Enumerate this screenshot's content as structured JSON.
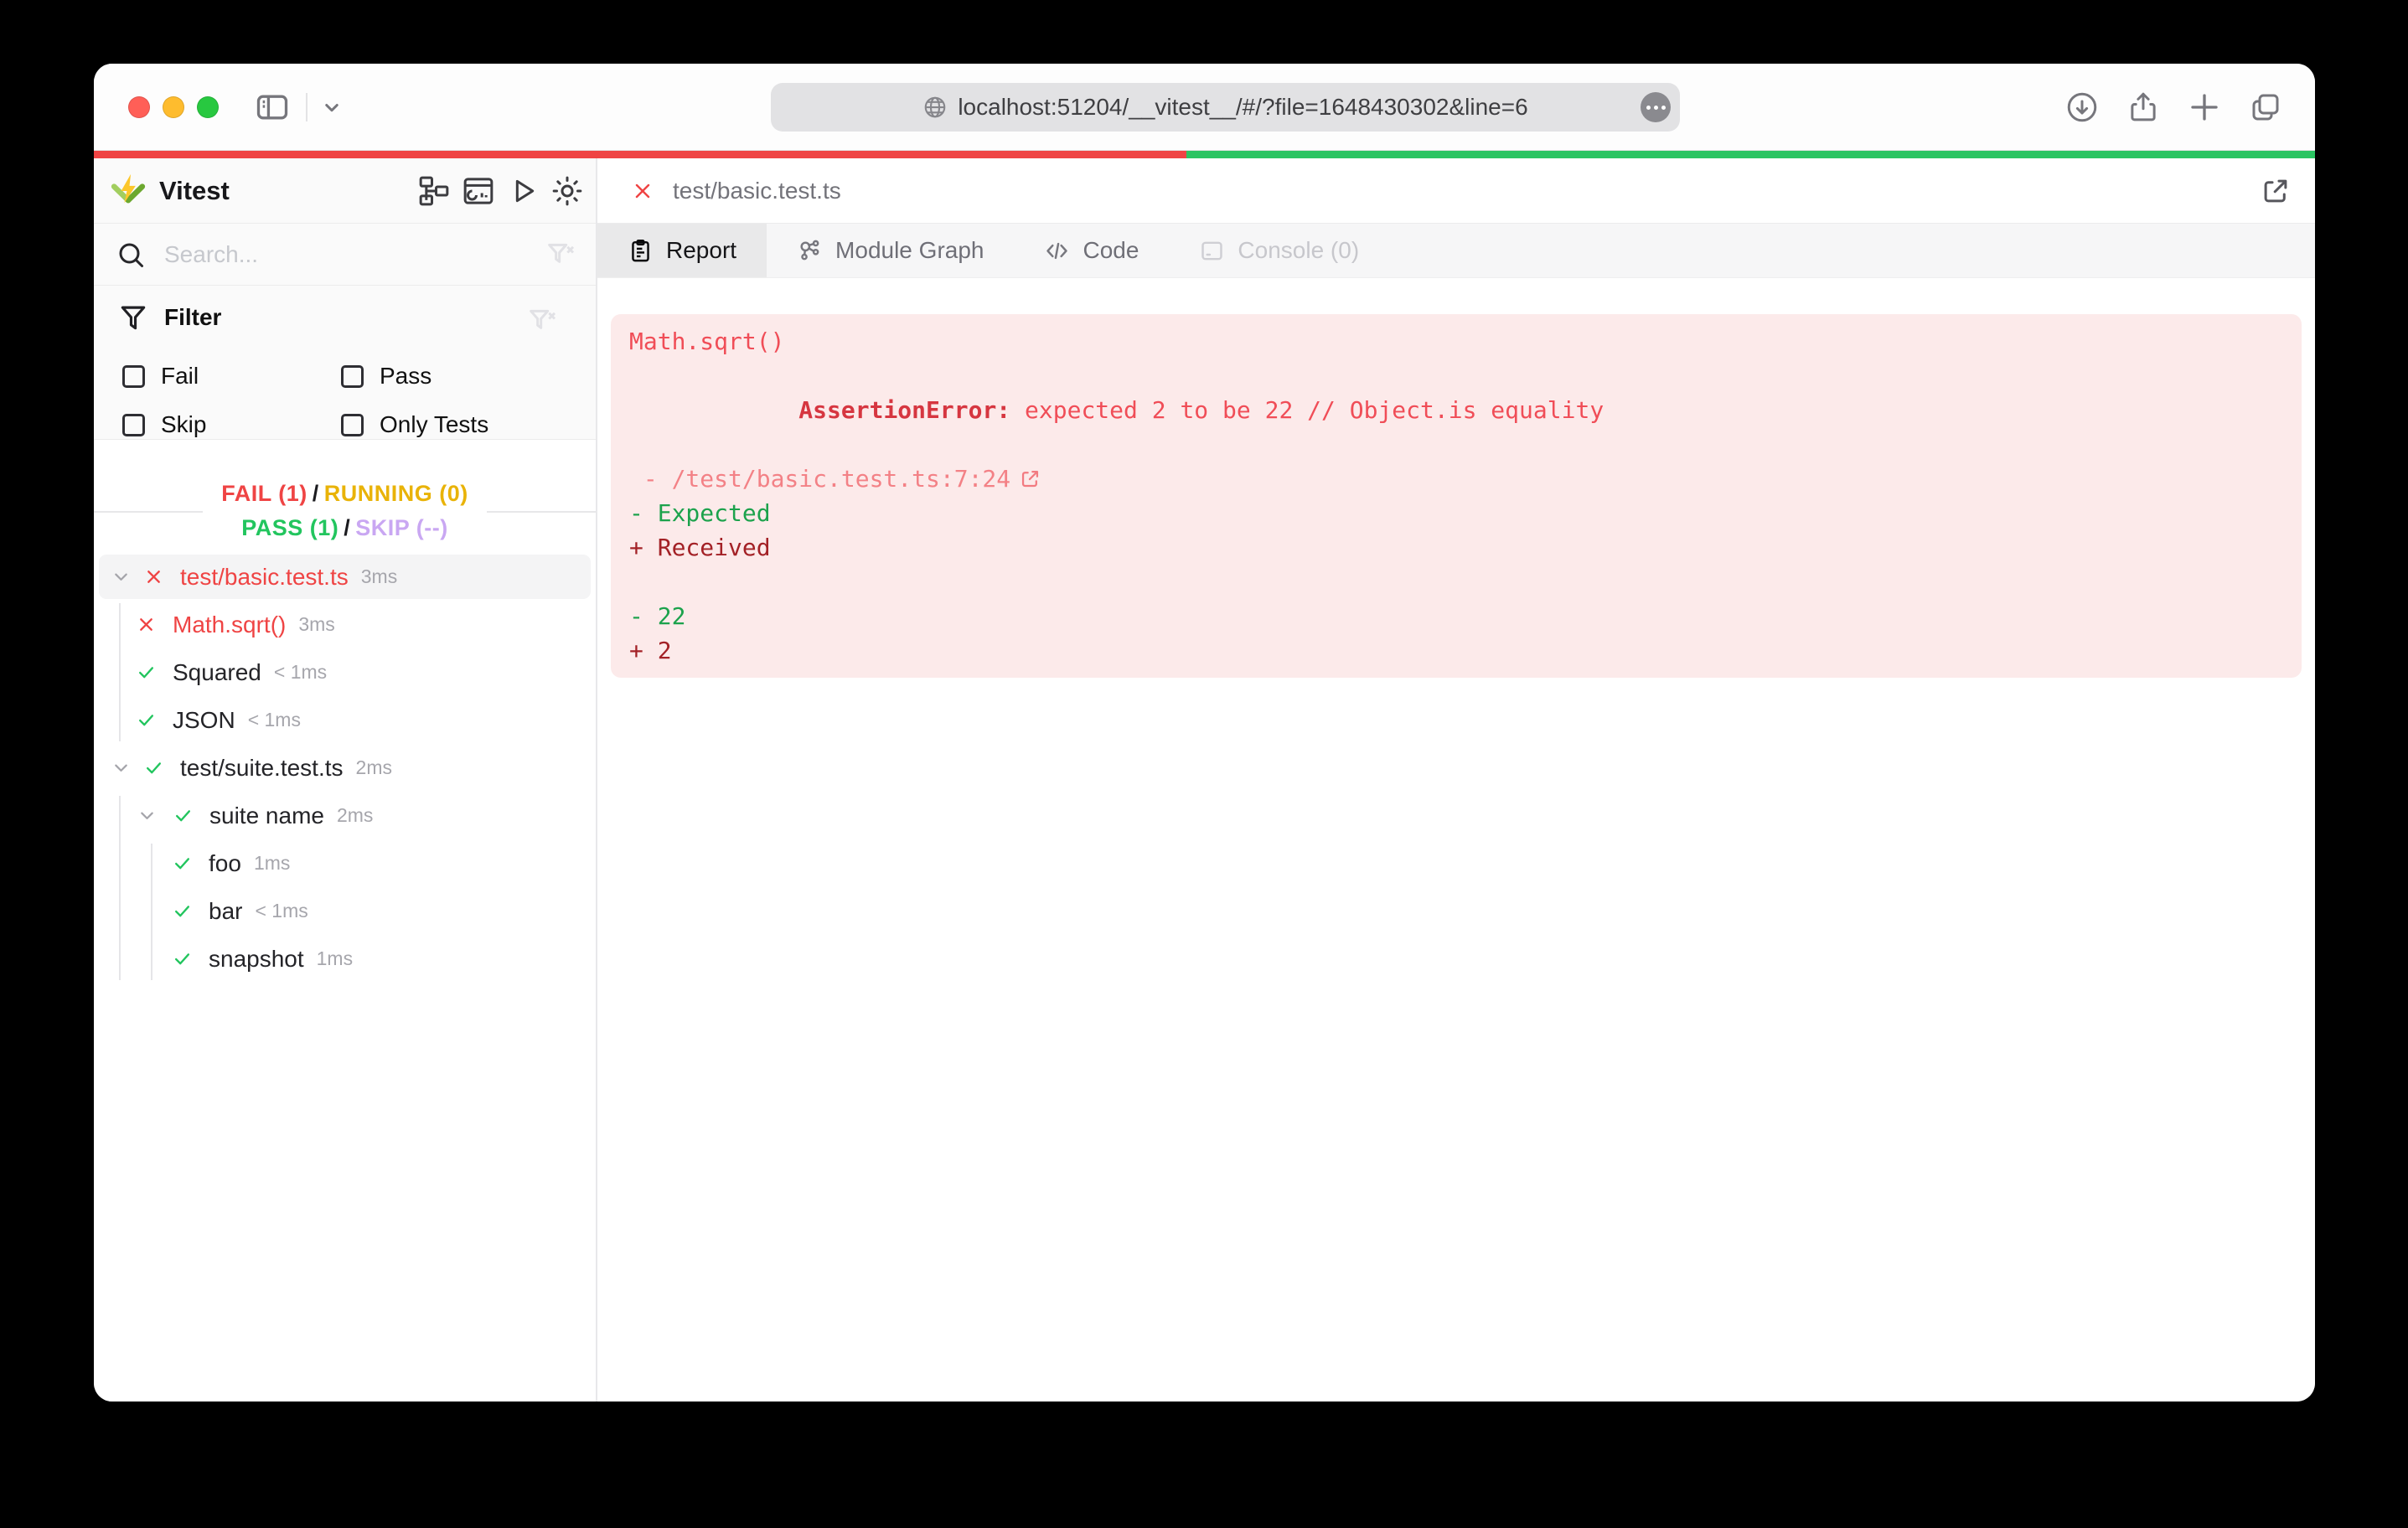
{
  "browser": {
    "url": "localhost:51204/__vitest__/#/?file=1648430302&line=6",
    "traffic_light_colors": [
      "#ff5f57",
      "#febc2e",
      "#28c840"
    ]
  },
  "progress": {
    "fail_count": 1,
    "pass_count": 1,
    "fail_color": "#ef4444",
    "pass_color": "#2bc462"
  },
  "sidebar": {
    "app_title": "Vitest",
    "search_placeholder": "Search...",
    "filter": {
      "title": "Filter",
      "options": [
        {
          "label": "Fail",
          "checked": false
        },
        {
          "label": "Pass",
          "checked": false
        },
        {
          "label": "Skip",
          "checked": false
        },
        {
          "label": "Only Tests",
          "checked": false
        }
      ]
    },
    "stats": {
      "fail": "FAIL (1)",
      "running": "RUNNING (0)",
      "pass": "PASS (1)",
      "skip": "SKIP (--)",
      "separator": "/",
      "colors": {
        "fail": "#ef4444",
        "running": "#e9b308",
        "pass": "#22c55e",
        "skip": "#c9a7f2"
      }
    },
    "tree": [
      {
        "label": "test/basic.test.ts",
        "duration": "3ms",
        "status": "fail",
        "selected": true
      },
      {
        "label": "Math.sqrt()",
        "duration": "3ms",
        "status": "fail"
      },
      {
        "label": "Squared",
        "duration": "< 1ms",
        "status": "pass"
      },
      {
        "label": "JSON",
        "duration": "< 1ms",
        "status": "pass"
      },
      {
        "label": "test/suite.test.ts",
        "duration": "2ms",
        "status": "pass"
      },
      {
        "label": "suite name",
        "duration": "2ms",
        "status": "pass"
      },
      {
        "label": "foo",
        "duration": "1ms",
        "status": "pass"
      },
      {
        "label": "bar",
        "duration": "< 1ms",
        "status": "pass"
      },
      {
        "label": "snapshot",
        "duration": "1ms",
        "status": "pass"
      }
    ]
  },
  "main": {
    "file_tab_title": "test/basic.test.ts",
    "tabs": [
      {
        "label": "Report",
        "active": true
      },
      {
        "label": "Module Graph"
      },
      {
        "label": "Code"
      },
      {
        "label": "Console (0)",
        "disabled": true
      }
    ],
    "error": {
      "test_name": "Math.sqrt()",
      "assertion_prefix": "AssertionError: ",
      "assertion_message": "expected 2 to be 22 // Object.is equality",
      "stack_line": " - /test/basic.test.ts:7:24",
      "diff_expected_label": "- Expected",
      "diff_received_label": "+ Received",
      "diff_expected_value": "- 22",
      "diff_received_value": "+ 2",
      "panel_bg": "#fceaea",
      "colors": {
        "error": "#f04d57",
        "expected": "#1ca24c",
        "received": "#a32126"
      }
    }
  }
}
